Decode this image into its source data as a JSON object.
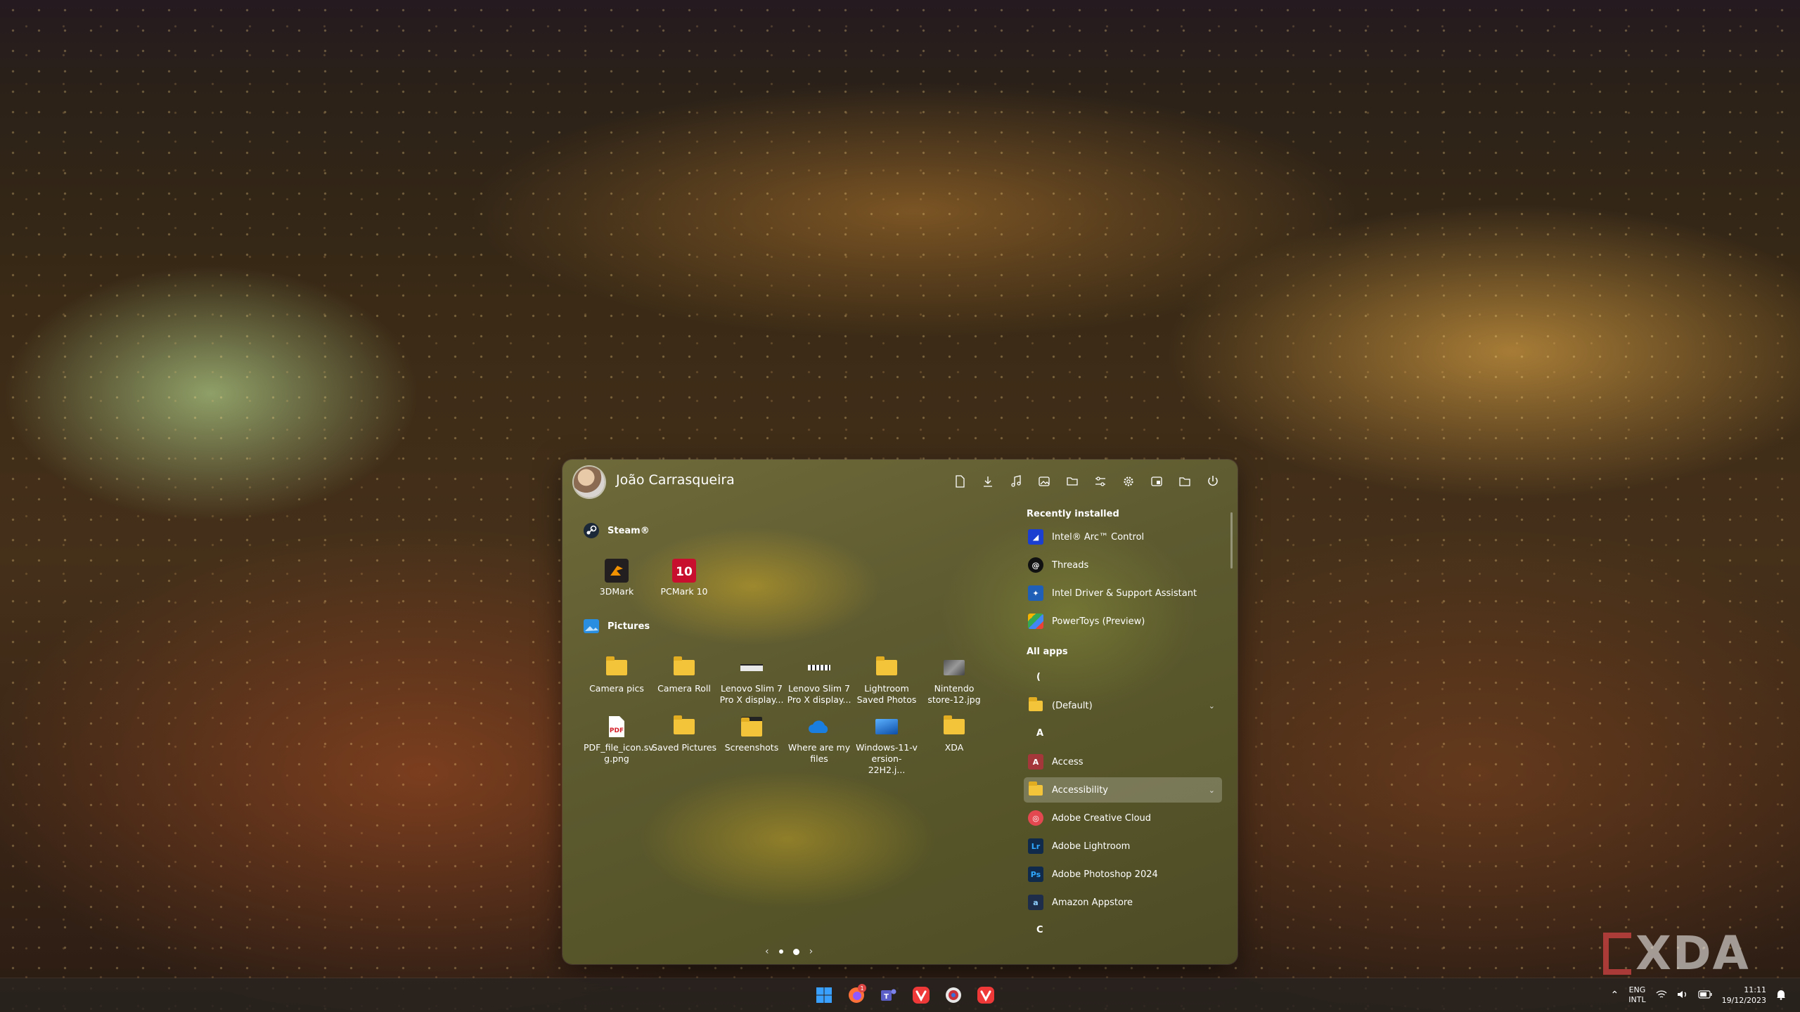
{
  "start_menu": {
    "user_name": "João Carrasqueira",
    "header_icons": [
      "documents-icon",
      "downloads-icon",
      "music-icon",
      "pictures-icon",
      "network-folder-icon",
      "settings-sliders-icon",
      "gear-icon",
      "file-explorer-icon",
      "folder-icon",
      "power-icon"
    ],
    "groups": [
      {
        "title": "Steam®",
        "icon": "steam-icon",
        "items": [
          {
            "label1": "3DMark",
            "label2": "",
            "icon": "3dmark-icon"
          },
          {
            "label1": "PCMark 10",
            "label2": "",
            "icon": "pcmark-icon"
          }
        ]
      },
      {
        "title": "Pictures",
        "icon": "pictures-icon",
        "items": [
          {
            "label1": "Camera pics",
            "label2": "",
            "icon": "folder-icon"
          },
          {
            "label1": "Camera Roll",
            "label2": "",
            "icon": "folder-icon"
          },
          {
            "label1": "Lenovo Slim 7",
            "label2": "Pro X display...",
            "icon": "image-thumbnail-icon"
          },
          {
            "label1": "Lenovo Slim 7",
            "label2": "Pro X display...",
            "icon": "image-thumbnail-icon"
          },
          {
            "label1": "Lightroom",
            "label2": "Saved Photos",
            "icon": "folder-icon"
          },
          {
            "label1": "Nintendo",
            "label2": "store-12.jpg",
            "icon": "image-thumbnail-icon"
          },
          {
            "label1": "PDF_file_icon.sv",
            "label2": "g.png",
            "icon": "pdf-icon"
          },
          {
            "label1": "Saved Pictures",
            "label2": "",
            "icon": "folder-icon"
          },
          {
            "label1": "Screenshots",
            "label2": "",
            "icon": "folder-icon"
          },
          {
            "label1": "Where are my",
            "label2": "files",
            "icon": "onedrive-icon"
          },
          {
            "label1": "Windows-11-v",
            "label2": "ersion-22H2.j...",
            "icon": "image-thumbnail-icon"
          },
          {
            "label1": "XDA",
            "label2": "",
            "icon": "folder-icon"
          }
        ]
      }
    ],
    "recently_installed_title": "Recently installed",
    "recently_installed": [
      {
        "label": "Intel® Arc™ Control",
        "icon": "intel-arc-icon",
        "color": "#1a3fd1"
      },
      {
        "label": "Threads",
        "icon": "threads-icon",
        "color": "#111111"
      },
      {
        "label": "Intel Driver & Support Assistant",
        "icon": "intel-dsa-icon",
        "color": "#1f5fb8"
      },
      {
        "label": "PowerToys (Preview)",
        "icon": "powertoys-icon",
        "color": "#3a3a3a"
      }
    ],
    "all_apps_title": "All apps",
    "all_apps": [
      {
        "type": "letter",
        "label": "("
      },
      {
        "type": "folder",
        "label": "(Default)",
        "icon": "folder-icon"
      },
      {
        "type": "letter",
        "label": "A"
      },
      {
        "type": "app",
        "label": "Access",
        "icon": "access-icon",
        "color": "#a4373a",
        "glyph": "A"
      },
      {
        "type": "folder",
        "label": "Accessibility",
        "icon": "folder-icon",
        "selected": true
      },
      {
        "type": "app",
        "label": "Adobe Creative Cloud",
        "icon": "creative-cloud-icon",
        "color": "#e34850",
        "glyph": "◎"
      },
      {
        "type": "app",
        "label": "Adobe Lightroom",
        "icon": "lightroom-icon",
        "color": "#0f2a4a",
        "glyph": "Lr"
      },
      {
        "type": "app",
        "label": "Adobe Photoshop 2024",
        "icon": "photoshop-icon",
        "color": "#0f2a4a",
        "glyph": "Ps"
      },
      {
        "type": "app",
        "label": "Amazon Appstore",
        "icon": "amazon-appstore-icon",
        "color": "#1e2e4a",
        "glyph": "a"
      },
      {
        "type": "letter",
        "label": "C"
      }
    ]
  },
  "taskbar": {
    "apps": [
      {
        "name": "start-button",
        "icon": "windows-logo-icon"
      },
      {
        "name": "firefox-button",
        "icon": "firefox-icon",
        "badge": "1"
      },
      {
        "name": "teams-button",
        "icon": "teams-icon"
      },
      {
        "name": "vivaldi-button",
        "icon": "vivaldi-icon"
      },
      {
        "name": "app-button",
        "icon": "round-app-icon"
      },
      {
        "name": "vivaldi-button-2",
        "icon": "vivaldi-icon"
      }
    ],
    "tray": {
      "lang_top": "ENG",
      "lang_bottom": "INTL",
      "time": "11:11",
      "date": "19/12/2023"
    }
  },
  "watermark": "XDA"
}
